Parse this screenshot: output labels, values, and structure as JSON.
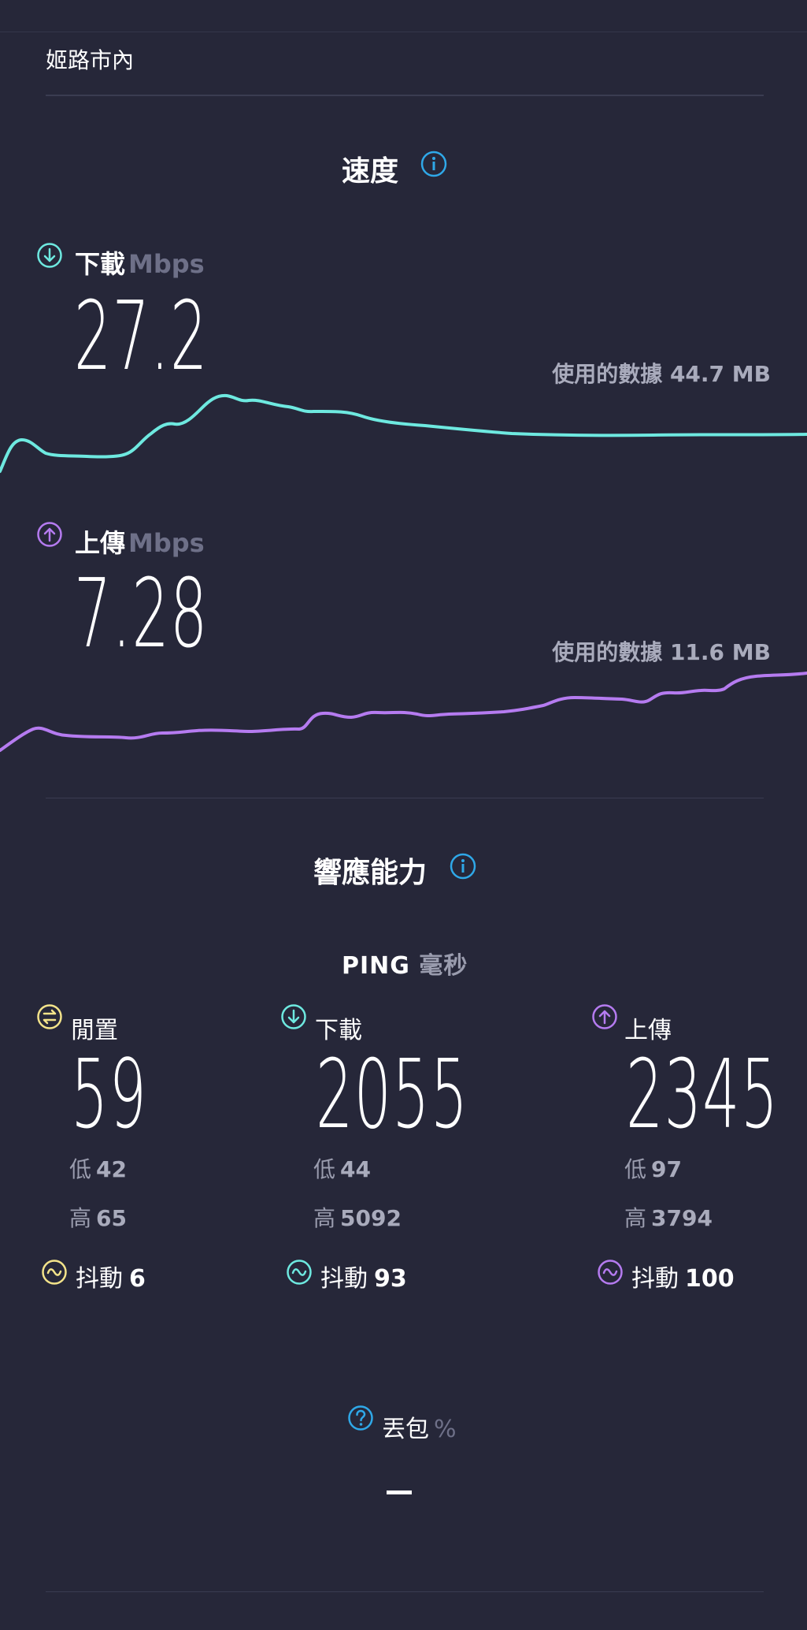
{
  "header": {
    "location": "姬路市內"
  },
  "speed": {
    "title": "速度",
    "download": {
      "label": "下載",
      "unit": "Mbps",
      "value": "27.2",
      "data_used": "使用的數據 44.7 MB",
      "color": "#6ee9e0"
    },
    "upload": {
      "label": "上傳",
      "unit": "Mbps",
      "value": "7.28",
      "data_used": "使用的數據 11.6 MB",
      "color": "#b57bf0"
    }
  },
  "responsiveness": {
    "title": "響應能力",
    "ping_label": "PING",
    "ping_unit": "毫秒",
    "idle": {
      "label": "閒置",
      "value": "59",
      "low_label": "低",
      "low": "42",
      "high_label": "高",
      "high": "65",
      "jitter_label": "抖動",
      "jitter": "6",
      "color": "#f3e38a"
    },
    "download": {
      "label": "下載",
      "value": "2055",
      "low_label": "低",
      "low": "44",
      "high_label": "高",
      "high": "5092",
      "jitter_label": "抖動",
      "jitter": "93",
      "color": "#6ee9e0"
    },
    "upload": {
      "label": "上傳",
      "value": "2345",
      "low_label": "低",
      "low": "97",
      "high_label": "高",
      "high": "3794",
      "jitter_label": "抖動",
      "jitter": "100",
      "color": "#b57bf0"
    }
  },
  "packet_loss": {
    "label": "丟包",
    "unit": "%",
    "value": "—"
  },
  "icons": {
    "info": "info-icon",
    "download": "arrow-down-circle-icon",
    "upload": "arrow-up-circle-icon",
    "idle": "idle-circle-icon",
    "jitter": "wave-circle-icon",
    "help": "question-circle-icon"
  },
  "accent": "#2fa8e8"
}
